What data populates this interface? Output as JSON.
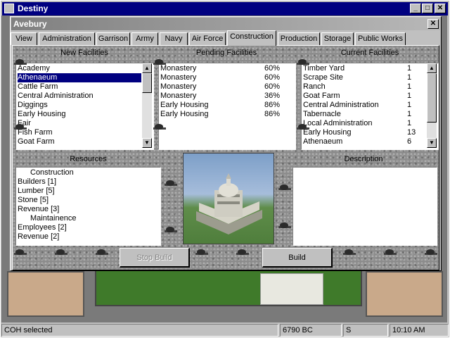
{
  "window": {
    "title": "Destiny",
    "buttons": [
      "_",
      "□",
      "✕"
    ]
  },
  "dialog": {
    "title": "Avebury",
    "close": "✕"
  },
  "tabs": [
    {
      "label": "View"
    },
    {
      "label": "Administration"
    },
    {
      "label": "Garrison"
    },
    {
      "label": "Army"
    },
    {
      "label": "Navy"
    },
    {
      "label": "Air Force"
    },
    {
      "label": "Construction"
    },
    {
      "label": "Production"
    },
    {
      "label": "Storage"
    },
    {
      "label": "Public Works"
    }
  ],
  "active_tab": "Construction",
  "new_facilities": {
    "label": "New Facilities",
    "items": [
      "Academy",
      "Athenaeum",
      "Cattle Farm",
      "Central Administration",
      "Diggings",
      "Early Housing",
      "Fair",
      "Fish Farm",
      "Goat Farm"
    ],
    "selected": "Athenaeum"
  },
  "pending_facilities": {
    "label": "Pending Facilities",
    "items": [
      {
        "name": "Monastery",
        "pct": "60%"
      },
      {
        "name": "Monastery",
        "pct": "60%"
      },
      {
        "name": "Monastery",
        "pct": "60%"
      },
      {
        "name": "Monastery",
        "pct": "36%"
      },
      {
        "name": "Early Housing",
        "pct": "86%"
      },
      {
        "name": "Early Housing",
        "pct": "86%"
      }
    ]
  },
  "current_facilities": {
    "label": "Current Facilities",
    "items": [
      {
        "name": "Timber Yard",
        "count": "1"
      },
      {
        "name": "Scrape Site",
        "count": "1"
      },
      {
        "name": "Ranch",
        "count": "1"
      },
      {
        "name": "Goat Farm",
        "count": "1"
      },
      {
        "name": "Central Administration",
        "count": "1"
      },
      {
        "name": "Tabernacle",
        "count": "1"
      },
      {
        "name": "Local Administration",
        "count": "1"
      },
      {
        "name": "Early Housing",
        "count": "13"
      },
      {
        "name": "Athenaeum",
        "count": "6"
      }
    ]
  },
  "resources": {
    "label": "Resources",
    "lines": [
      {
        "text": "Construction",
        "indent": true
      },
      {
        "text": "Builders [1]"
      },
      {
        "text": "Lumber [5]"
      },
      {
        "text": "Stone [5]"
      },
      {
        "text": "Revenue [3]"
      },
      {
        "text": "Maintainence",
        "indent": true
      },
      {
        "text": "Employees [2]"
      },
      {
        "text": "Revenue [2]"
      }
    ]
  },
  "description": {
    "label": "Description",
    "text": ""
  },
  "buttons": {
    "stop_build": "Stop Build",
    "build": "Build"
  },
  "status": {
    "message": "COH selected",
    "date": "6790 BC",
    "direction": "S",
    "time": "10:10 AM"
  }
}
